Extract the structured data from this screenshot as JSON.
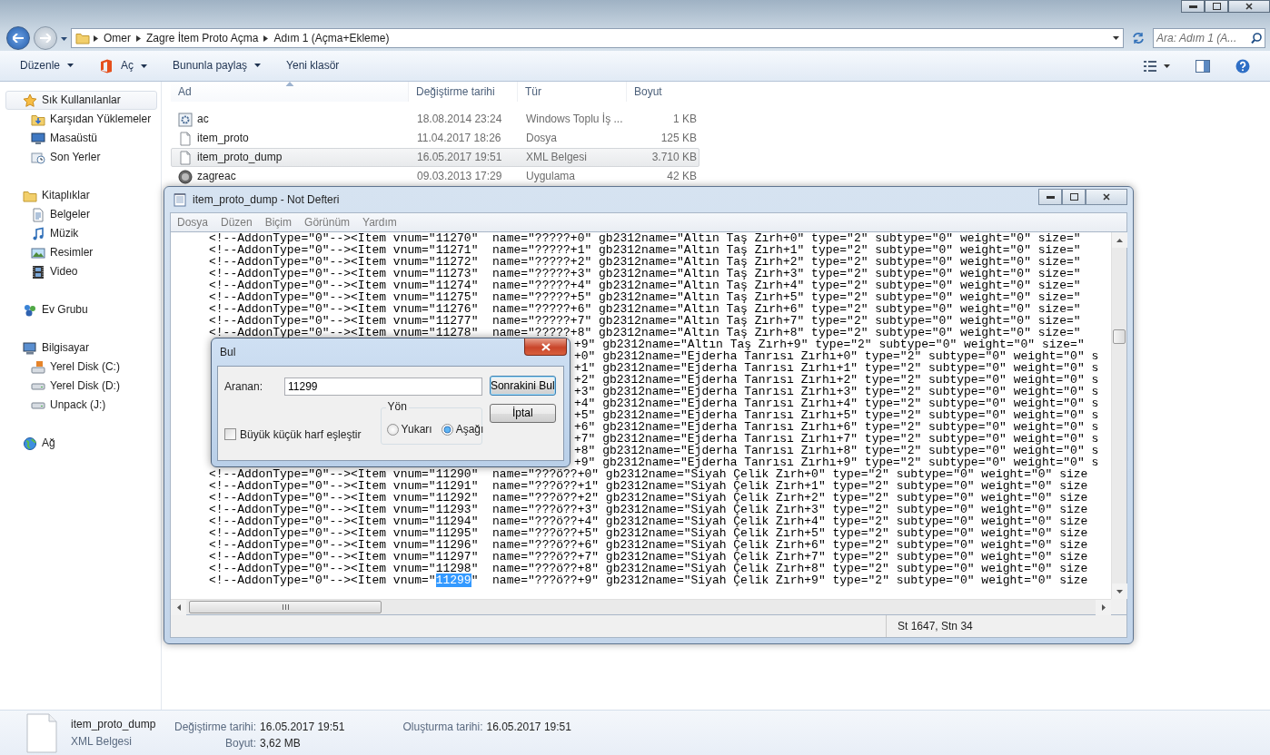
{
  "explorer": {
    "breadcrumb": [
      "Omer",
      "Zagre İtem Proto Açma",
      "Adım 1 (Açma+Ekleme)"
    ],
    "search": {
      "placeholder": "Ara: Adım 1 (A..."
    },
    "toolbar": [
      {
        "kind": "plain",
        "label": "Düzenle",
        "dropdown": true
      },
      {
        "kind": "app",
        "label": "Aç",
        "dropdown": true
      },
      {
        "kind": "plain",
        "label": "Bununla paylaş",
        "dropdown": true
      },
      {
        "kind": "plain",
        "label": "Yeni klasör",
        "dropdown": false
      }
    ],
    "nav": [
      {
        "label": "Sık Kullanılanlar",
        "selected": true,
        "children": [
          {
            "label": "Karşıdan Yüklemeler",
            "selected": false
          },
          {
            "label": "Masaüstü",
            "selected": false
          },
          {
            "label": "Son Yerler",
            "selected": false
          }
        ]
      },
      {
        "label": "Kitaplıklar",
        "selected": false,
        "children": [
          {
            "label": "Belgeler",
            "selected": false
          },
          {
            "label": "Müzik",
            "selected": false
          },
          {
            "label": "Resimler",
            "selected": false
          },
          {
            "label": "Video",
            "selected": false
          }
        ]
      },
      {
        "label": "Ev Grubu",
        "selected": false
      },
      {
        "label": "Bilgisayar",
        "selected": false,
        "children": [
          {
            "label": "Yerel Disk (C:)",
            "selected": false
          },
          {
            "label": "Yerel Disk (D:)",
            "selected": false
          },
          {
            "label": "Unpack (J:)",
            "selected": false
          }
        ]
      },
      {
        "label": "Ağ",
        "selected": false
      }
    ],
    "columns": [
      {
        "label": "Ad",
        "sorted": true
      },
      {
        "label": "Değiştirme tarihi",
        "sorted": false
      },
      {
        "label": "Tür",
        "sorted": false
      },
      {
        "label": "Boyut",
        "sorted": false
      }
    ],
    "files": [
      {
        "name": "ac",
        "modified": "18.08.2014 23:24",
        "type": "Windows Toplu İş ...",
        "size": "1 KB",
        "selected": false
      },
      {
        "name": "item_proto",
        "modified": "11.04.2017 18:26",
        "type": "Dosya",
        "size": "125 KB",
        "selected": false
      },
      {
        "name": "item_proto_dump",
        "modified": "16.05.2017 19:51",
        "type": "XML Belgesi",
        "size": "3.710 KB",
        "selected": true
      },
      {
        "name": "zagreac",
        "modified": "09.03.2013 17:29",
        "type": "Uygulama",
        "size": "42 KB",
        "selected": false
      }
    ],
    "details": {
      "name": "item_proto_dump",
      "type": "XML Belgesi",
      "groups": [
        [
          {
            "label": "Değiştirme tarihi:",
            "value": "16.05.2017 19:51"
          },
          {
            "label": "Boyut:",
            "value": "3,62 MB"
          }
        ],
        [
          {
            "label": "Oluşturma tarihi:",
            "value": "16.05.2017 19:51"
          }
        ]
      ]
    }
  },
  "notepad": {
    "title": "item_proto_dump - Not Defteri",
    "menu": [
      "Dosya",
      "Düzen",
      "Biçim",
      "Görünüm",
      "Yardım"
    ],
    "lines": [
      {
        "kind": "full",
        "text": "<!--AddonType=\"0\"--><Item vnum=\"11270\"  name=\"?????+0\" gb2312name=\"Altın Taş Zırh+0\" type=\"2\" subtype=\"0\" weight=\"0\" size=\""
      },
      {
        "kind": "full",
        "text": "<!--AddonType=\"0\"--><Item vnum=\"11271\"  name=\"?????+1\" gb2312name=\"Altın Taş Zırh+1\" type=\"2\" subtype=\"0\" weight=\"0\" size=\""
      },
      {
        "kind": "full",
        "text": "<!--AddonType=\"0\"--><Item vnum=\"11272\"  name=\"?????+2\" gb2312name=\"Altın Taş Zırh+2\" type=\"2\" subtype=\"0\" weight=\"0\" size=\""
      },
      {
        "kind": "full",
        "text": "<!--AddonType=\"0\"--><Item vnum=\"11273\"  name=\"?????+3\" gb2312name=\"Altın Taş Zırh+3\" type=\"2\" subtype=\"0\" weight=\"0\" size=\""
      },
      {
        "kind": "full",
        "text": "<!--AddonType=\"0\"--><Item vnum=\"11274\"  name=\"?????+4\" gb2312name=\"Altın Taş Zırh+4\" type=\"2\" subtype=\"0\" weight=\"0\" size=\""
      },
      {
        "kind": "full",
        "text": "<!--AddonType=\"0\"--><Item vnum=\"11275\"  name=\"?????+5\" gb2312name=\"Altın Taş Zırh+5\" type=\"2\" subtype=\"0\" weight=\"0\" size=\""
      },
      {
        "kind": "full",
        "text": "<!--AddonType=\"0\"--><Item vnum=\"11276\"  name=\"?????+6\" gb2312name=\"Altın Taş Zırh+6\" type=\"2\" subtype=\"0\" weight=\"0\" size=\""
      },
      {
        "kind": "full",
        "text": "<!--AddonType=\"0\"--><Item vnum=\"11277\"  name=\"?????+7\" gb2312name=\"Altın Taş Zırh+7\" type=\"2\" subtype=\"0\" weight=\"0\" size=\""
      },
      {
        "kind": "full",
        "text": "<!--AddonType=\"0\"--><Item vnum=\"11278\"  name=\"?????+8\" gb2312name=\"Altın Taş Zırh+8\" type=\"2\" subtype=\"0\" weight=\"0\" size=\""
      },
      {
        "kind": "partial",
        "text": "+9\" gb2312name=\"Altın Taş Zırh+9\" type=\"2\" subtype=\"0\" weight=\"0\" size=\""
      },
      {
        "kind": "partial",
        "text": "+0\" gb2312name=\"Ejderha Tanrısı Zırhı+0\" type=\"2\" subtype=\"0\" weight=\"0\" s"
      },
      {
        "kind": "partial",
        "text": "+1\" gb2312name=\"Ejderha Tanrısı Zırhı+1\" type=\"2\" subtype=\"0\" weight=\"0\" s"
      },
      {
        "kind": "partial",
        "text": "+2\" gb2312name=\"Ejderha Tanrısı Zırhı+2\" type=\"2\" subtype=\"0\" weight=\"0\" s"
      },
      {
        "kind": "partial",
        "text": "+3\" gb2312name=\"Ejderha Tanrısı Zırhı+3\" type=\"2\" subtype=\"0\" weight=\"0\" s"
      },
      {
        "kind": "partial",
        "text": "+4\" gb2312name=\"Ejderha Tanrısı Zırhı+4\" type=\"2\" subtype=\"0\" weight=\"0\" s"
      },
      {
        "kind": "partial",
        "text": "+5\" gb2312name=\"Ejderha Tanrısı Zırhı+5\" type=\"2\" subtype=\"0\" weight=\"0\" s"
      },
      {
        "kind": "partial",
        "text": "+6\" gb2312name=\"Ejderha Tanrısı Zırhı+6\" type=\"2\" subtype=\"0\" weight=\"0\" s"
      },
      {
        "kind": "partial",
        "text": "+7\" gb2312name=\"Ejderha Tanrısı Zırhı+7\" type=\"2\" subtype=\"0\" weight=\"0\" s"
      },
      {
        "kind": "partial",
        "text": "+8\" gb2312name=\"Ejderha Tanrısı Zırhı+8\" type=\"2\" subtype=\"0\" weight=\"0\" s"
      },
      {
        "kind": "partial",
        "text": "+9\" gb2312name=\"Ejderha Tanrısı Zırhı+9\" type=\"2\" subtype=\"0\" weight=\"0\" s"
      },
      {
        "kind": "full",
        "text": "<!--AddonType=\"0\"--><Item vnum=\"11290\"  name=\"???ö??+0\" gb2312name=\"Siyah Çelik Zırh+0\" type=\"2\" subtype=\"0\" weight=\"0\" size"
      },
      {
        "kind": "full",
        "text": "<!--AddonType=\"0\"--><Item vnum=\"11291\"  name=\"???ö??+1\" gb2312name=\"Siyah Çelik Zırh+1\" type=\"2\" subtype=\"0\" weight=\"0\" size"
      },
      {
        "kind": "full",
        "text": "<!--AddonType=\"0\"--><Item vnum=\"11292\"  name=\"???ö??+2\" gb2312name=\"Siyah Çelik Zırh+2\" type=\"2\" subtype=\"0\" weight=\"0\" size"
      },
      {
        "kind": "full",
        "text": "<!--AddonType=\"0\"--><Item vnum=\"11293\"  name=\"???ö??+3\" gb2312name=\"Siyah Çelik Zırh+3\" type=\"2\" subtype=\"0\" weight=\"0\" size"
      },
      {
        "kind": "full",
        "text": "<!--AddonType=\"0\"--><Item vnum=\"11294\"  name=\"???ö??+4\" gb2312name=\"Siyah Çelik Zırh+4\" type=\"2\" subtype=\"0\" weight=\"0\" size"
      },
      {
        "kind": "full",
        "text": "<!--AddonType=\"0\"--><Item vnum=\"11295\"  name=\"???ö??+5\" gb2312name=\"Siyah Çelik Zırh+5\" type=\"2\" subtype=\"0\" weight=\"0\" size"
      },
      {
        "kind": "full",
        "text": "<!--AddonType=\"0\"--><Item vnum=\"11296\"  name=\"???ö??+6\" gb2312name=\"Siyah Çelik Zırh+6\" type=\"2\" subtype=\"0\" weight=\"0\" size"
      },
      {
        "kind": "full",
        "text": "<!--AddonType=\"0\"--><Item vnum=\"11297\"  name=\"???ö??+7\" gb2312name=\"Siyah Çelik Zırh+7\" type=\"2\" subtype=\"0\" weight=\"0\" size"
      },
      {
        "kind": "full",
        "text": "<!--AddonType=\"0\"--><Item vnum=\"11298\"  name=\"???ö??+8\" gb2312name=\"Siyah Çelik Zırh+8\" type=\"2\" subtype=\"0\" weight=\"0\" size"
      },
      {
        "kind": "full",
        "text": "<!--AddonType=\"0\"--><Item vnum=\"",
        "selected_text": "11299",
        "text_after": "\"  name=\"???ö??+9\" gb2312name=\"Siyah Çelik Zırh+9\" type=\"2\" subtype=\"0\" weight=\"0\" size"
      }
    ],
    "status": "St 1647, Stn 34"
  },
  "find_dialog": {
    "title": "Bul",
    "search_label": "Aranan:",
    "search_value": "11299",
    "next_button": "Sonrakini Bul",
    "cancel_button": "İptal",
    "direction_label": "Yön",
    "directions": [
      {
        "label": "Yukarı",
        "selected": false
      },
      {
        "label": "Aşağı",
        "selected": true
      }
    ],
    "match_case": {
      "label": "Büyük küçük harf eşleştir",
      "checked": false
    }
  }
}
